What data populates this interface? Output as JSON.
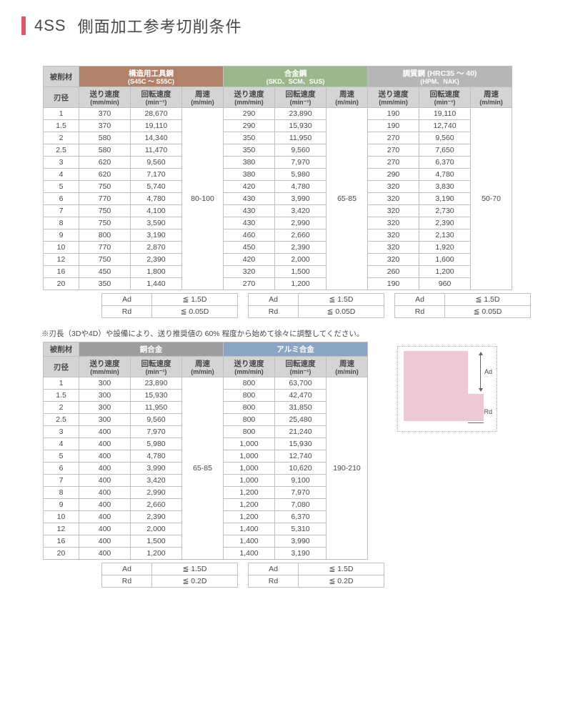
{
  "title": {
    "code": "4SS",
    "text": "側面加工参考切削条件"
  },
  "headers": {
    "material": "被削材",
    "diameter": "刃径",
    "feed": "送り速度",
    "feed_unit": "(mm/min)",
    "rpm": "回転速度",
    "rpm_unit": "(min⁻¹)",
    "vs": "周速",
    "vs_unit": "(m/min)"
  },
  "materials": {
    "m1": {
      "name": "構造用工具鋼",
      "sub": "(S45C ～ S55C)"
    },
    "m2": {
      "name": "合金鋼",
      "sub": "(SKD、SCM、SUS)"
    },
    "m3": {
      "name": "調質鋼 (HRC35 ～ 40)",
      "sub": "(HPM、NAK)"
    },
    "m4": {
      "name": "銅合金",
      "sub": ""
    },
    "m5": {
      "name": "アルミ合金",
      "sub": ""
    }
  },
  "diameters": [
    "1",
    "1.5",
    "2",
    "2.5",
    "3",
    "4",
    "5",
    "6",
    "7",
    "8",
    "9",
    "10",
    "12",
    "16",
    "20"
  ],
  "t1": {
    "m1": {
      "feed": [
        "370",
        "370",
        "580",
        "580",
        "620",
        "620",
        "750",
        "770",
        "750",
        "750",
        "800",
        "770",
        "750",
        "450",
        "350"
      ],
      "rpm": [
        "28,670",
        "19,110",
        "14,340",
        "11,470",
        "9,560",
        "7,170",
        "5,740",
        "4,780",
        "4,100",
        "3,590",
        "3,190",
        "2,870",
        "2,390",
        "1,800",
        "1,440"
      ],
      "vs": "80-100"
    },
    "m2": {
      "feed": [
        "290",
        "290",
        "350",
        "350",
        "380",
        "380",
        "420",
        "430",
        "430",
        "430",
        "460",
        "450",
        "420",
        "320",
        "270"
      ],
      "rpm": [
        "23,890",
        "15,930",
        "11,950",
        "9,560",
        "7,970",
        "5,980",
        "4,780",
        "3,990",
        "3,420",
        "2,990",
        "2,660",
        "2,390",
        "2,000",
        "1,500",
        "1,200"
      ],
      "vs": "65-85"
    },
    "m3": {
      "feed": [
        "190",
        "190",
        "270",
        "270",
        "270",
        "290",
        "320",
        "320",
        "320",
        "320",
        "320",
        "320",
        "320",
        "260",
        "190"
      ],
      "rpm": [
        "19,110",
        "12,740",
        "9,560",
        "7,650",
        "6,370",
        "4,780",
        "3,830",
        "3,190",
        "2,730",
        "2,390",
        "2,130",
        "1,920",
        "1,600",
        "1,200",
        "960"
      ],
      "vs": "50-70"
    }
  },
  "t2": {
    "m4": {
      "feed": [
        "300",
        "300",
        "300",
        "300",
        "400",
        "400",
        "400",
        "400",
        "400",
        "400",
        "400",
        "400",
        "400",
        "400",
        "400"
      ],
      "rpm": [
        "23,890",
        "15,930",
        "11,950",
        "9,560",
        "7,970",
        "5,980",
        "4,780",
        "3,990",
        "3,420",
        "2,990",
        "2,660",
        "2,390",
        "2,000",
        "1,500",
        "1,200"
      ],
      "vs": "65-85"
    },
    "m5": {
      "feed": [
        "800",
        "800",
        "800",
        "800",
        "800",
        "1,000",
        "1,000",
        "1,000",
        "1,000",
        "1,200",
        "1,200",
        "1,200",
        "1,400",
        "1,400",
        "1,400"
      ],
      "rpm": [
        "63,700",
        "42,470",
        "31,850",
        "25,480",
        "21,240",
        "15,930",
        "12,740",
        "10,620",
        "9,100",
        "7,970",
        "7,080",
        "6,370",
        "5,310",
        "3,990",
        "3,190"
      ],
      "vs": "190-210"
    }
  },
  "ad_rd": {
    "ad_label": "Ad",
    "rd_label": "Rd",
    "t1": {
      "ad": "≦ 1.5D",
      "rd": "≦ 0.05D"
    },
    "t2": {
      "ad": "≦ 1.5D",
      "rd": "≦ 0.2D"
    }
  },
  "note": "※刃長（3Dや4D）や設備により、送り推奨値の 60% 程度から始めて徐々に調整してください。",
  "diagram": {
    "ad": "Ad",
    "rd": "Rd"
  }
}
